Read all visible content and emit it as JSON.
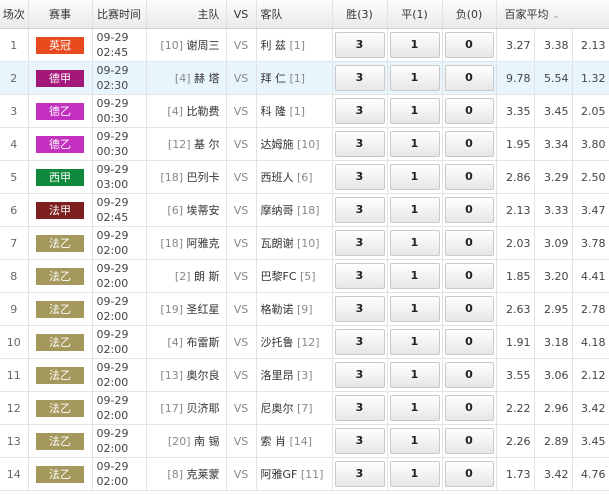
{
  "header": {
    "no": "场次",
    "league": "赛事",
    "time": "比赛时间",
    "home": "主队",
    "vs": "VS",
    "away": "客队",
    "win": "胜(3)",
    "draw": "平(1)",
    "loss": "负(0)",
    "avg": "百家平均",
    "sort_icon": "chevron-down-icon"
  },
  "rows": [
    {
      "no": "1",
      "league": "英冠",
      "color": "#e8491d",
      "date": "09-29",
      "time": "02:45",
      "home_rank": "[10]",
      "home": "谢周三",
      "vs": "VS",
      "away": "利 兹",
      "away_rank": "[1]",
      "w": "3",
      "d": "1",
      "l": "0",
      "o1": "3.27",
      "o2": "3.38",
      "o3": "2.13"
    },
    {
      "no": "2",
      "league": "德甲",
      "color": "#a3177a",
      "date": "09-29",
      "time": "02:30",
      "home_rank": "[4]",
      "home": "赫 塔",
      "vs": "VS",
      "away": "拜 仁",
      "away_rank": "[1]",
      "w": "3",
      "d": "1",
      "l": "0",
      "o1": "9.78",
      "o2": "5.54",
      "o3": "1.32"
    },
    {
      "no": "3",
      "league": "德乙",
      "color": "#c32fbf",
      "date": "09-29",
      "time": "00:30",
      "home_rank": "[4]",
      "home": "比勒费",
      "vs": "VS",
      "away": "科 隆",
      "away_rank": "[1]",
      "w": "3",
      "d": "1",
      "l": "0",
      "o1": "3.35",
      "o2": "3.45",
      "o3": "2.05"
    },
    {
      "no": "4",
      "league": "德乙",
      "color": "#c32fbf",
      "date": "09-29",
      "time": "00:30",
      "home_rank": "[12]",
      "home": "基 尔",
      "vs": "VS",
      "away": "达姆施",
      "away_rank": "[10]",
      "w": "3",
      "d": "1",
      "l": "0",
      "o1": "1.95",
      "o2": "3.34",
      "o3": "3.80"
    },
    {
      "no": "5",
      "league": "西甲",
      "color": "#0f8a3c",
      "date": "09-29",
      "time": "03:00",
      "home_rank": "[18]",
      "home": "巴列卡",
      "vs": "VS",
      "away": "西班人",
      "away_rank": "[6]",
      "w": "3",
      "d": "1",
      "l": "0",
      "o1": "2.86",
      "o2": "3.29",
      "o3": "2.50"
    },
    {
      "no": "6",
      "league": "法甲",
      "color": "#7d1f1f",
      "date": "09-29",
      "time": "02:45",
      "home_rank": "[6]",
      "home": "埃蒂安",
      "vs": "VS",
      "away": "摩纳哥",
      "away_rank": "[18]",
      "w": "3",
      "d": "1",
      "l": "0",
      "o1": "2.13",
      "o2": "3.33",
      "o3": "3.47"
    },
    {
      "no": "7",
      "league": "法乙",
      "color": "#a5985c",
      "date": "09-29",
      "time": "02:00",
      "home_rank": "[18]",
      "home": "阿雅克",
      "vs": "VS",
      "away": "瓦朗谢",
      "away_rank": "[10]",
      "w": "3",
      "d": "1",
      "l": "0",
      "o1": "2.03",
      "o2": "3.09",
      "o3": "3.78"
    },
    {
      "no": "8",
      "league": "法乙",
      "color": "#a5985c",
      "date": "09-29",
      "time": "02:00",
      "home_rank": "[2]",
      "home": "朗 斯",
      "vs": "VS",
      "away": "巴黎FC",
      "away_rank": "[5]",
      "w": "3",
      "d": "1",
      "l": "0",
      "o1": "1.85",
      "o2": "3.20",
      "o3": "4.41"
    },
    {
      "no": "9",
      "league": "法乙",
      "color": "#a5985c",
      "date": "09-29",
      "time": "02:00",
      "home_rank": "[19]",
      "home": "圣红星",
      "vs": "VS",
      "away": "格勒诺",
      "away_rank": "[9]",
      "w": "3",
      "d": "1",
      "l": "0",
      "o1": "2.63",
      "o2": "2.95",
      "o3": "2.78"
    },
    {
      "no": "10",
      "league": "法乙",
      "color": "#a5985c",
      "date": "09-29",
      "time": "02:00",
      "home_rank": "[4]",
      "home": "布雷斯",
      "vs": "VS",
      "away": "沙托鲁",
      "away_rank": "[12]",
      "w": "3",
      "d": "1",
      "l": "0",
      "o1": "1.91",
      "o2": "3.18",
      "o3": "4.18"
    },
    {
      "no": "11",
      "league": "法乙",
      "color": "#a5985c",
      "date": "09-29",
      "time": "02:00",
      "home_rank": "[13]",
      "home": "奥尔良",
      "vs": "VS",
      "away": "洛里昂",
      "away_rank": "[3]",
      "w": "3",
      "d": "1",
      "l": "0",
      "o1": "3.55",
      "o2": "3.06",
      "o3": "2.12"
    },
    {
      "no": "12",
      "league": "法乙",
      "color": "#a5985c",
      "date": "09-29",
      "time": "02:00",
      "home_rank": "[17]",
      "home": "贝济耶",
      "vs": "VS",
      "away": "尼奥尔",
      "away_rank": "[7]",
      "w": "3",
      "d": "1",
      "l": "0",
      "o1": "2.22",
      "o2": "2.96",
      "o3": "3.42"
    },
    {
      "no": "13",
      "league": "法乙",
      "color": "#a5985c",
      "date": "09-29",
      "time": "02:00",
      "home_rank": "[20]",
      "home": "南 锡",
      "vs": "VS",
      "away": "索 肖",
      "away_rank": "[14]",
      "w": "3",
      "d": "1",
      "l": "0",
      "o1": "2.26",
      "o2": "2.89",
      "o3": "3.45"
    },
    {
      "no": "14",
      "league": "法乙",
      "color": "#a5985c",
      "date": "09-29",
      "time": "02:00",
      "home_rank": "[8]",
      "home": "克莱蒙",
      "vs": "VS",
      "away": "阿雅GF",
      "away_rank": "[11]",
      "w": "3",
      "d": "1",
      "l": "0",
      "o1": "1.73",
      "o2": "3.42",
      "o3": "4.76"
    }
  ]
}
